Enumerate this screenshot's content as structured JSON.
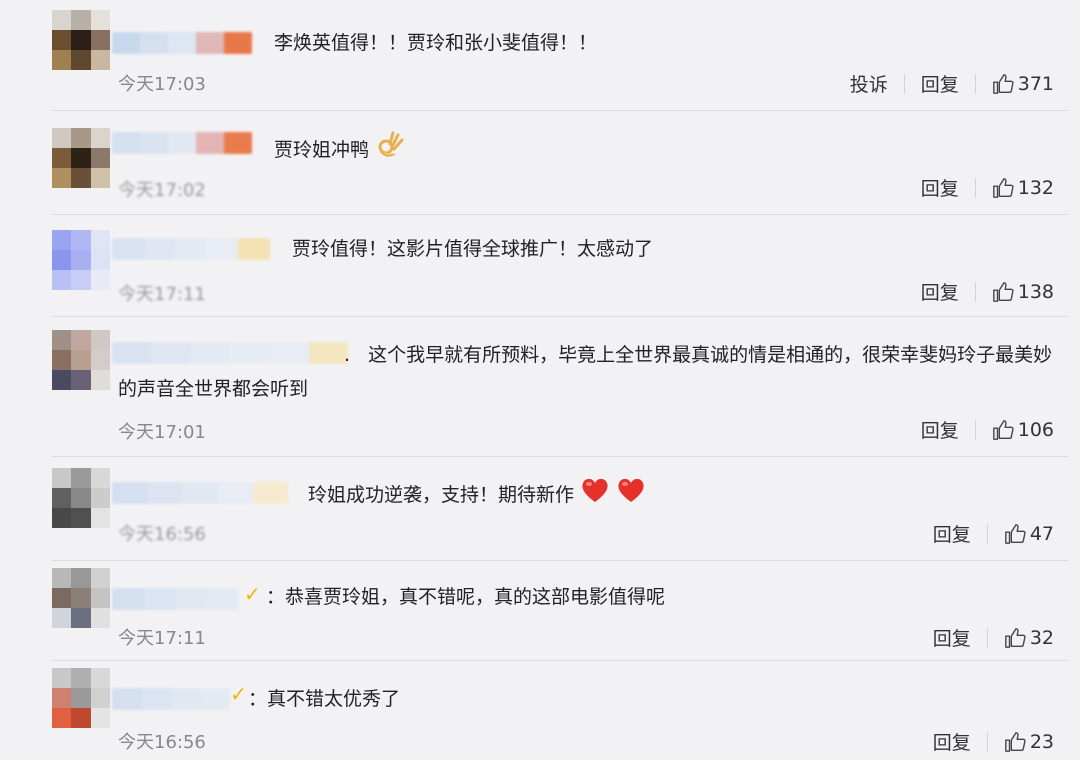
{
  "labels": {
    "report": "投诉",
    "reply": "回复"
  },
  "comments": [
    {
      "text": "李焕英值得！！贾玲和张小斐值得！！",
      "time": "今天17:03",
      "likes": "371",
      "has_report": true
    },
    {
      "text": "贾玲姐冲鸭",
      "time": "今天17:02",
      "likes": "132",
      "emoji": "ok-hand-icon"
    },
    {
      "text": "贾玲值得！这影片值得全球推广！太感动了",
      "time": "今天17:11",
      "likes": "138"
    },
    {
      "prefix": ".",
      "text": "这个我早就有所预料，毕竟上全世界最真诚的情是相通的，很荣幸斐妈玲子最美妙的声音全世界都会听到",
      "time": "今天17:01",
      "likes": "106"
    },
    {
      "text": "玲姐成功逆袭，支持！期待新作",
      "time": "今天16:56",
      "likes": "47",
      "emoji": "heart-icon"
    },
    {
      "prefix": "：",
      "text": "恭喜贾玲姐，真不错呢，真的这部电影值得呢",
      "time": "今天17:11",
      "likes": "32",
      "vip": "✓"
    },
    {
      "prefix": "：",
      "text": "真不错太优秀了",
      "time": "今天16:56",
      "likes": "23",
      "vip": "✓"
    }
  ],
  "colors": {
    "background": "#f2f2f5",
    "text": "#222222",
    "meta": "#888888",
    "vip": "#f5b400",
    "heart": "#e8302a"
  }
}
